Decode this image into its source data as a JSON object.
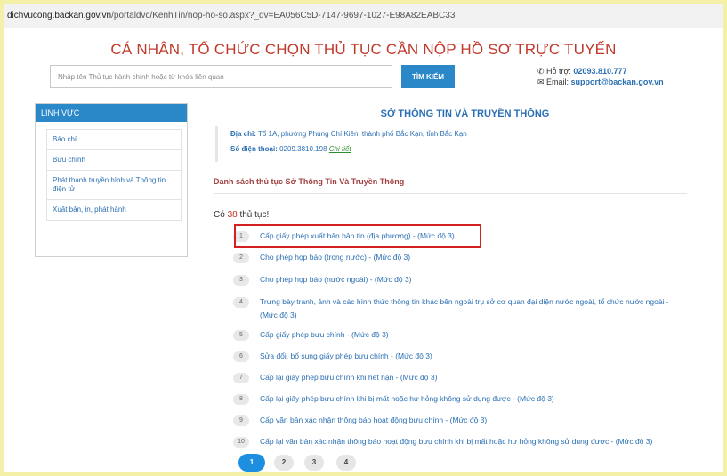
{
  "address_bar": {
    "host": "dichvucong.backan.gov.vn",
    "path": "/portaldvc/KenhTin/nop-ho-so.aspx?_dv=EA056C5D-7147-9697-1027-E98A82EABC33"
  },
  "page_title": "CÁ NHÂN, TỔ CHỨC CHỌN THỦ TỤC CẦN NỘP HỒ SƠ TRỰC TUYẾN",
  "search": {
    "placeholder": "Nhập tên Thủ tục hành chính hoặc từ khóa liên quan",
    "value": "",
    "button_label": "TÌM KIẾM"
  },
  "contact": {
    "hotline_label": "Hỗ trợ:",
    "hotline_value": "02093.810.777",
    "email_label": "Email:",
    "email_value": "support@backan.gov.vn"
  },
  "sidebar": {
    "header": "LĨNH VỰC",
    "items": [
      {
        "label": "Báo chí"
      },
      {
        "label": "Bưu chính"
      },
      {
        "label": "Phát thanh truyền hình và Thông tin điện tử"
      },
      {
        "label": "Xuất bản, in, phát hành"
      }
    ]
  },
  "org": {
    "name": "SỞ THÔNG TIN VÀ TRUYỀN THÔNG",
    "address_label": "Địa chỉ:",
    "address": "Tổ 1A, phường Phùng Chí Kiên, thành phố Bắc Kạn, tỉnh Bắc Kạn",
    "phone_label": "Số điện thoại:",
    "phone": "0209.3810.198",
    "detail_link": "Chi tiết"
  },
  "list_title": "Danh sách thủ tục Sở Thông Tin Và Truyền Thông",
  "count": {
    "prefix": "Có ",
    "number": "38",
    "suffix": " thủ tục!"
  },
  "procedures": [
    {
      "num": "1",
      "text": "Cấp giấy phép xuất bản bản tin (địa phương) - (Mức độ 3)"
    },
    {
      "num": "2",
      "text": "Cho phép họp báo (trong nước) - (Mức độ 3)"
    },
    {
      "num": "3",
      "text": "Cho phép họp báo (nước ngoài) - (Mức độ 3)"
    },
    {
      "num": "4",
      "text": "Trưng bày tranh, ảnh và các hình thức thông tin khác bên ngoài trụ sở cơ quan đại diện nước ngoài, tổ chức nước ngoài - (Mức độ 3)"
    },
    {
      "num": "5",
      "text": "Cấp giấy phép bưu chính - (Mức độ 3)"
    },
    {
      "num": "6",
      "text": "Sửa đổi, bổ sung giấy phép bưu chính - (Mức độ 3)"
    },
    {
      "num": "7",
      "text": "Cấp lại giấy phép bưu chính khi hết hạn - (Mức độ 3)"
    },
    {
      "num": "8",
      "text": "Cấp lại giấy phép bưu chính khi bị mất hoặc hư hỏng không sử dụng được - (Mức độ 3)"
    },
    {
      "num": "9",
      "text": "Cấp văn bản xác nhận thông báo hoạt động bưu chính - (Mức độ 3)"
    },
    {
      "num": "10",
      "text": "Cấp lại văn bản xác nhận thông báo hoạt động bưu chính khi bị mất hoặc hư hỏng không sử dụng được - (Mức độ 3)"
    }
  ],
  "pagination": {
    "pages": [
      "1",
      "2",
      "3",
      "4"
    ],
    "current": "1"
  },
  "colors": {
    "accent": "#2a88c8",
    "title_red": "#c0392b",
    "highlight_red": "#d32020"
  }
}
